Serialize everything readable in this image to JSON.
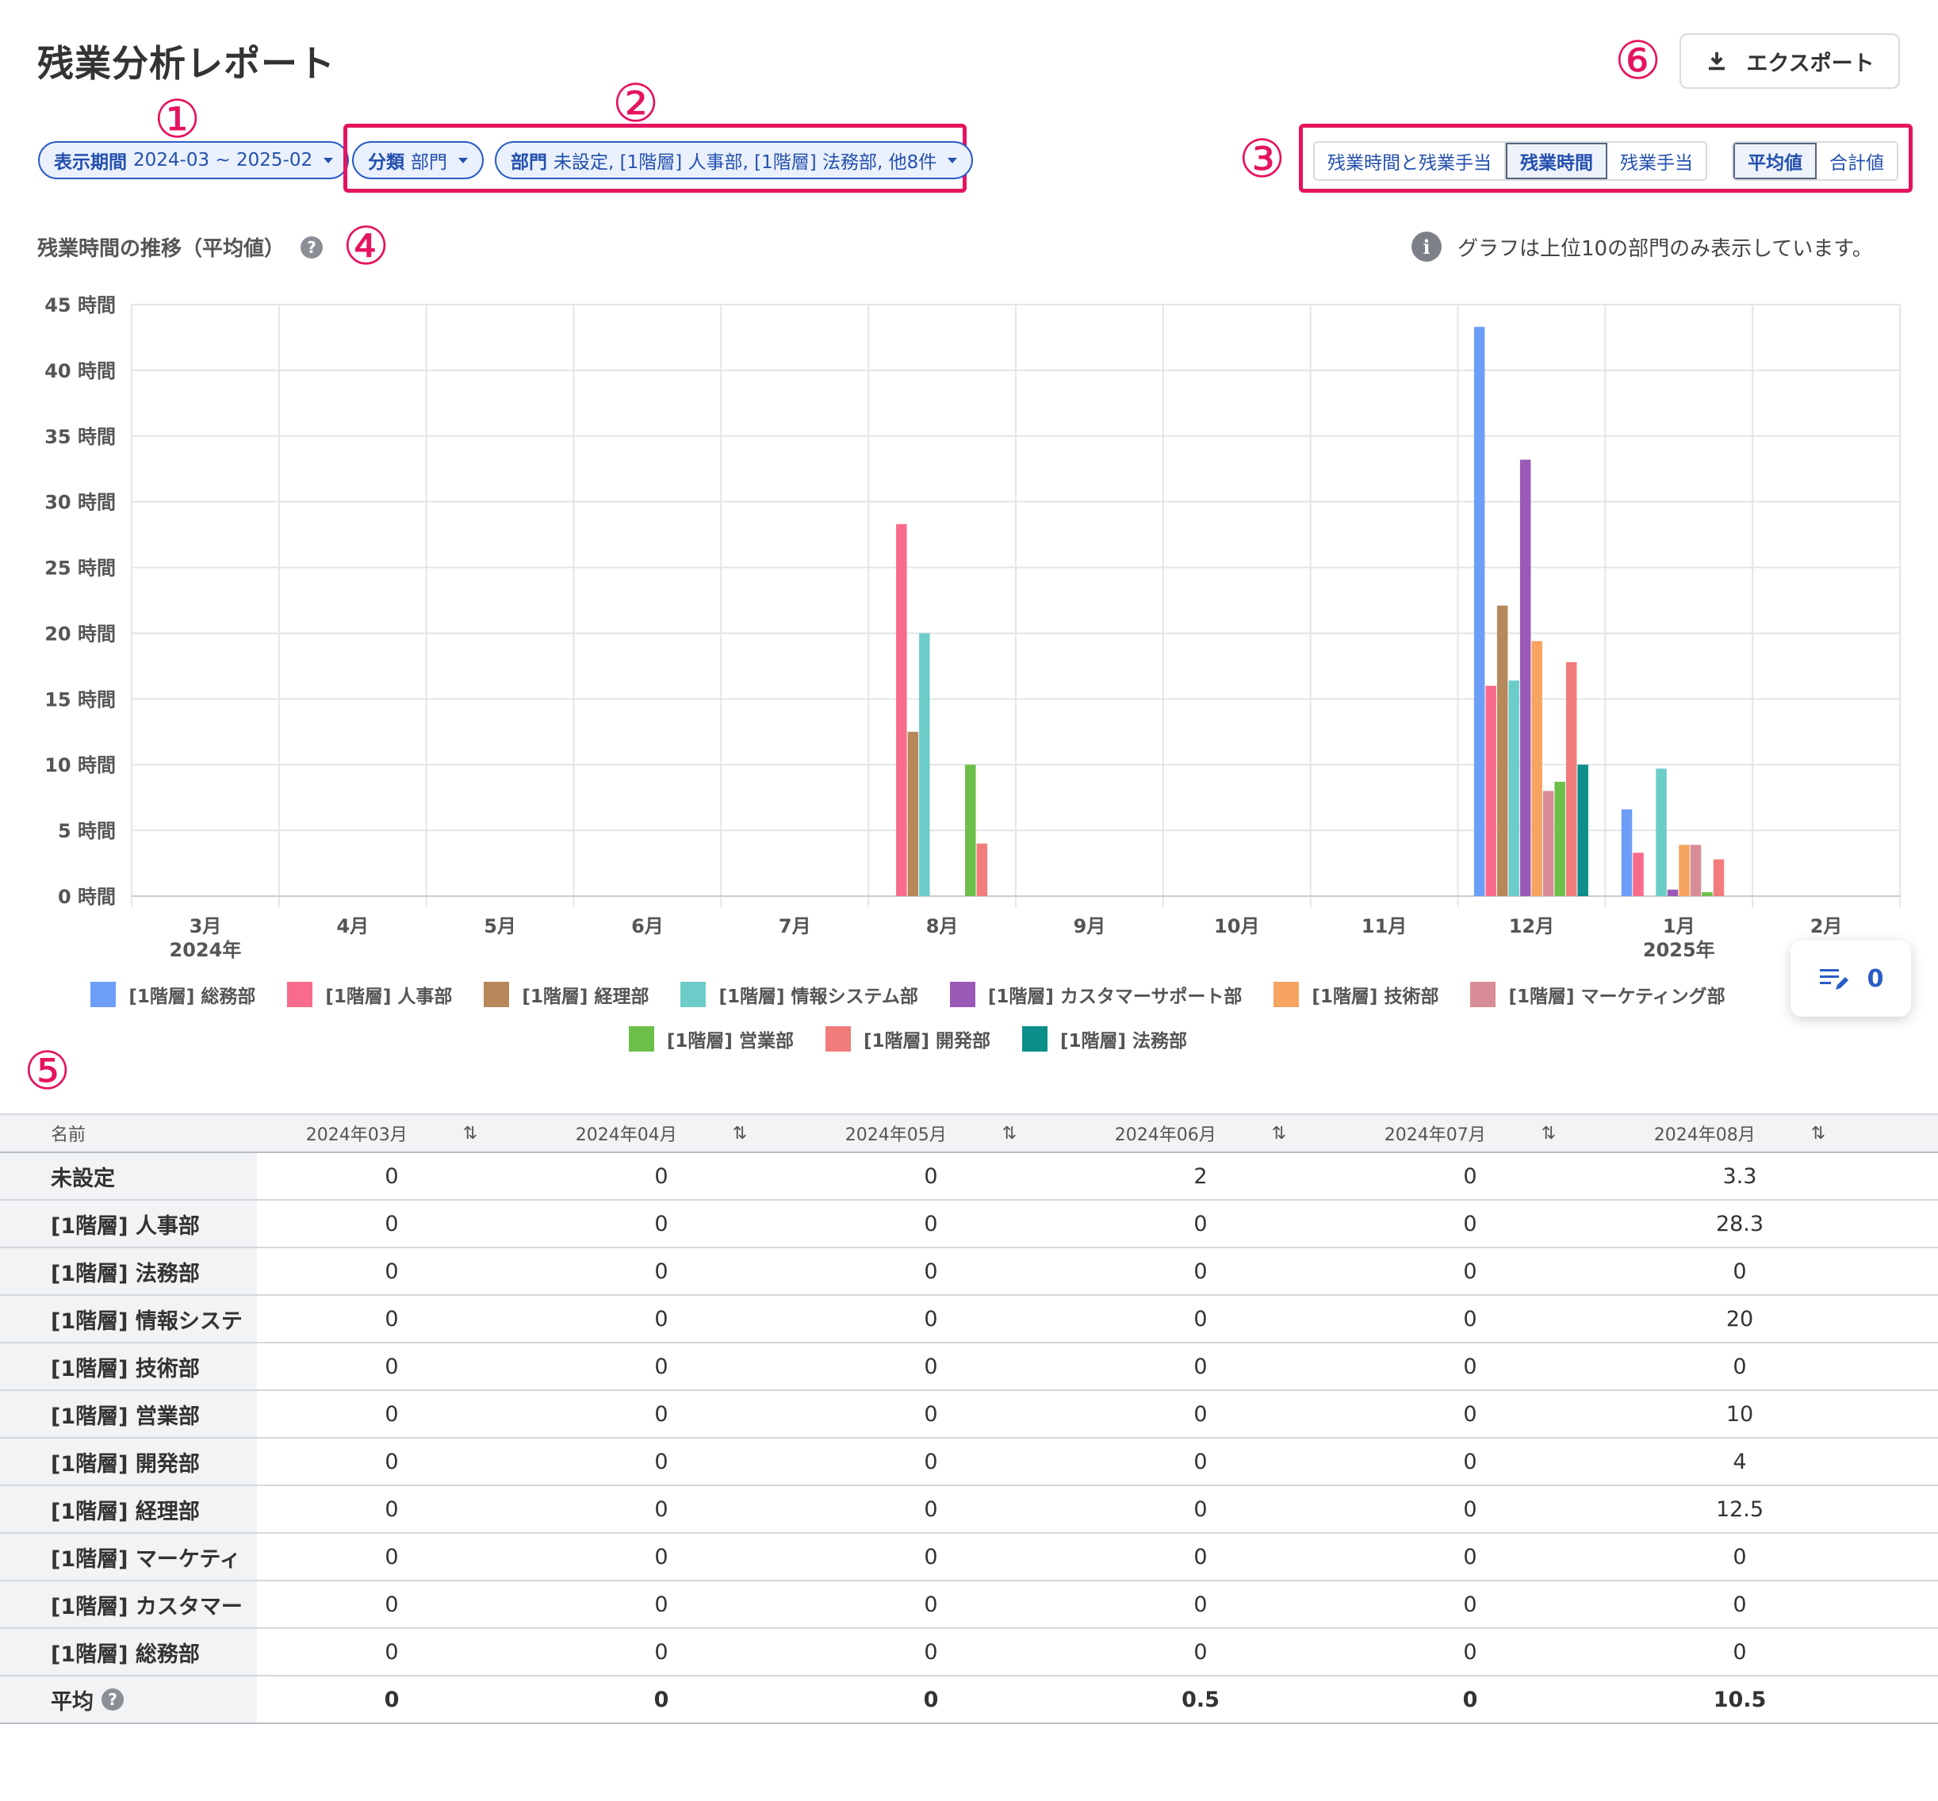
{
  "title": "残業分析レポート",
  "export_label": "エクスポート",
  "markers": [
    "①",
    "②",
    "③",
    "④",
    "⑤",
    "⑥"
  ],
  "filters": {
    "period": {
      "key": "表示期間",
      "value": "2024-03 ~ 2025-02"
    },
    "classification": {
      "key": "分類",
      "value": "部門"
    },
    "department": {
      "key": "部門",
      "value": "未設定, [1階層] 人事部, [1階層] 法務部, 他8件"
    }
  },
  "view_tabs": [
    "残業時間と残業手当",
    "残業時間",
    "残業手当"
  ],
  "view_active": "残業時間",
  "agg_tabs": [
    "平均値",
    "合計値"
  ],
  "agg_active": "平均値",
  "chart_title": "残業時間の推移（平均値）",
  "help_icon": "?",
  "info_icon": "i",
  "info_note": "グラフは上位10の部門のみ表示しています。",
  "fab_count": "0",
  "chart_data": {
    "type": "bar",
    "categories": [
      "3月",
      "4月",
      "5月",
      "6月",
      "7月",
      "8月",
      "9月",
      "10月",
      "11月",
      "12月",
      "1月",
      "2月"
    ],
    "year_labels": {
      "3月": "2024年",
      "1月": "2025年"
    },
    "y_unit": "時間",
    "ylim": [
      0,
      45
    ],
    "yticks": [
      0,
      5,
      10,
      15,
      20,
      25,
      30,
      35,
      40,
      45
    ],
    "grid": true,
    "legend_position": "bottom",
    "series": [
      {
        "name": "[1階層] 総務部",
        "color": "#6c9ef8",
        "values": [
          0,
          0,
          0,
          0,
          0,
          0,
          0,
          0,
          0,
          43.3,
          6.6,
          0
        ]
      },
      {
        "name": "[1階層] 人事部",
        "color": "#f96b8a",
        "values": [
          0,
          0,
          0,
          0,
          0,
          28.3,
          0,
          0,
          0,
          16,
          3.3,
          0
        ]
      },
      {
        "name": "[1階層] 経理部",
        "color": "#b6885a",
        "values": [
          0,
          0,
          0,
          0,
          0,
          12.5,
          0,
          0,
          0,
          22.1,
          0,
          0
        ]
      },
      {
        "name": "[1階層] 情報システム部",
        "color": "#6ccdc8",
        "values": [
          0,
          0,
          0,
          0,
          0,
          20,
          0,
          0,
          0,
          16.4,
          9.7,
          0
        ]
      },
      {
        "name": "[1階層] カスタマーサポート部",
        "color": "#9b59b6",
        "values": [
          0,
          0,
          0,
          0,
          0,
          0,
          0,
          0,
          0,
          33.2,
          0.5,
          0
        ]
      },
      {
        "name": "[1階層] 技術部",
        "color": "#f6a45f",
        "values": [
          0,
          0,
          0,
          0,
          0,
          0,
          0,
          0,
          0,
          19.4,
          3.9,
          0
        ]
      },
      {
        "name": "[1階層] マーケティング部",
        "color": "#d88c95",
        "values": [
          0,
          0,
          0,
          0,
          0,
          0,
          0,
          0,
          0,
          8,
          3.9,
          0
        ]
      },
      {
        "name": "[1階層] 営業部",
        "color": "#6cc04a",
        "values": [
          0,
          0,
          0,
          0,
          0,
          10,
          0,
          0,
          0,
          8.7,
          0.3,
          0
        ]
      },
      {
        "name": "[1階層] 開発部",
        "color": "#f07c7c",
        "values": [
          0,
          0,
          0,
          0,
          0,
          4,
          0,
          0,
          0,
          17.8,
          2.8,
          0
        ]
      },
      {
        "name": "[1階層] 法務部",
        "color": "#0c8f8a",
        "values": [
          0,
          0,
          0,
          0,
          0,
          0,
          0,
          0,
          0,
          10,
          0,
          0
        ]
      }
    ]
  },
  "legend_rows": [
    [
      "[1階層] 総務部",
      "[1階層] 人事部",
      "[1階層] 経理部",
      "[1階層] 情報システム部",
      "[1階層] カスタマーサポート部",
      "[1階層] 技術部",
      "[1階層] マーケティング部"
    ],
    [
      "[1階層] 営業部",
      "[1階層] 開発部",
      "[1階層] 法務部"
    ]
  ],
  "table": {
    "name_header": "名前",
    "columns": [
      "2024年03月",
      "2024年04月",
      "2024年05月",
      "2024年06月",
      "2024年07月",
      "2024年08月"
    ],
    "sort_icon": "⇅",
    "rows": [
      {
        "name": "未設定",
        "values": [
          "0",
          "0",
          "0",
          "2",
          "0",
          "3.3"
        ]
      },
      {
        "name": "[1階層] 人事部",
        "values": [
          "0",
          "0",
          "0",
          "0",
          "0",
          "28.3"
        ]
      },
      {
        "name": "[1階層] 法務部",
        "values": [
          "0",
          "0",
          "0",
          "0",
          "0",
          "0"
        ]
      },
      {
        "name": "[1階層] 情報システ",
        "values": [
          "0",
          "0",
          "0",
          "0",
          "0",
          "20"
        ]
      },
      {
        "name": "[1階層] 技術部",
        "values": [
          "0",
          "0",
          "0",
          "0",
          "0",
          "0"
        ]
      },
      {
        "name": "[1階層] 営業部",
        "values": [
          "0",
          "0",
          "0",
          "0",
          "0",
          "10"
        ]
      },
      {
        "name": "[1階層] 開発部",
        "values": [
          "0",
          "0",
          "0",
          "0",
          "0",
          "4"
        ]
      },
      {
        "name": "[1階層] 経理部",
        "values": [
          "0",
          "0",
          "0",
          "0",
          "0",
          "12.5"
        ]
      },
      {
        "name": "[1階層] マーケティ",
        "values": [
          "0",
          "0",
          "0",
          "0",
          "0",
          "0"
        ]
      },
      {
        "name": "[1階層] カスタマー",
        "values": [
          "0",
          "0",
          "0",
          "0",
          "0",
          "0"
        ]
      },
      {
        "name": "[1階層] 総務部",
        "values": [
          "0",
          "0",
          "0",
          "0",
          "0",
          "0"
        ]
      }
    ],
    "average": {
      "name": "平均",
      "values": [
        "0",
        "0",
        "0",
        "0.5",
        "0",
        "10.5"
      ]
    }
  }
}
